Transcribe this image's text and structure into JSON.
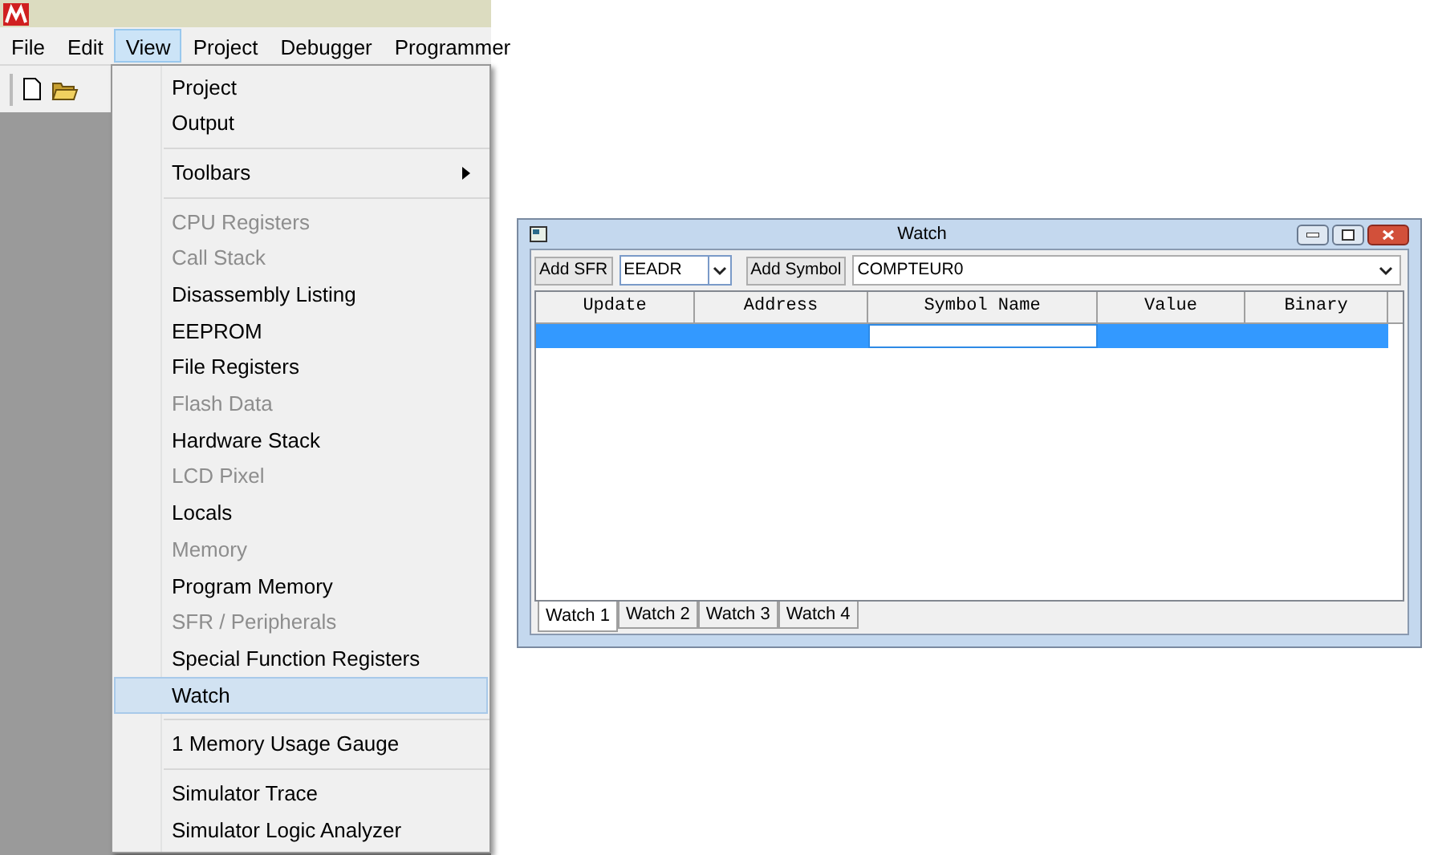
{
  "ide": {
    "menu_bar": [
      {
        "label": "File",
        "selected": false
      },
      {
        "label": "Edit",
        "selected": false
      },
      {
        "label": "View",
        "selected": true
      },
      {
        "label": "Project",
        "selected": false
      },
      {
        "label": "Debugger",
        "selected": false
      },
      {
        "label": "Programmer",
        "selected": false
      }
    ]
  },
  "view_menu": {
    "items": [
      {
        "kind": "item",
        "label": "Project",
        "disabled": false,
        "selected": false
      },
      {
        "kind": "item",
        "label": "Output",
        "disabled": false,
        "selected": false
      },
      {
        "kind": "separator"
      },
      {
        "kind": "submenu",
        "label": "Toolbars",
        "disabled": false,
        "selected": false
      },
      {
        "kind": "separator"
      },
      {
        "kind": "item",
        "label": "CPU Registers",
        "disabled": true,
        "selected": false
      },
      {
        "kind": "item",
        "label": "Call Stack",
        "disabled": true,
        "selected": false
      },
      {
        "kind": "item",
        "label": "Disassembly Listing",
        "disabled": false,
        "selected": false
      },
      {
        "kind": "item",
        "label": "EEPROM",
        "disabled": false,
        "selected": false
      },
      {
        "kind": "item",
        "label": "File Registers",
        "disabled": false,
        "selected": false
      },
      {
        "kind": "item",
        "label": "Flash Data",
        "disabled": true,
        "selected": false
      },
      {
        "kind": "item",
        "label": "Hardware Stack",
        "disabled": false,
        "selected": false
      },
      {
        "kind": "item",
        "label": "LCD Pixel",
        "disabled": true,
        "selected": false
      },
      {
        "kind": "item",
        "label": "Locals",
        "disabled": false,
        "selected": false
      },
      {
        "kind": "item",
        "label": "Memory",
        "disabled": true,
        "selected": false
      },
      {
        "kind": "item",
        "label": "Program Memory",
        "disabled": false,
        "selected": false
      },
      {
        "kind": "item",
        "label": "SFR / Peripherals",
        "disabled": true,
        "selected": false
      },
      {
        "kind": "item",
        "label": "Special Function Registers",
        "disabled": false,
        "selected": false
      },
      {
        "kind": "item",
        "label": "Watch",
        "disabled": false,
        "selected": true
      },
      {
        "kind": "separator"
      },
      {
        "kind": "item",
        "label": "1 Memory Usage Gauge",
        "disabled": false,
        "selected": false
      },
      {
        "kind": "separator"
      },
      {
        "kind": "item",
        "label": "Simulator Trace",
        "disabled": false,
        "selected": false
      },
      {
        "kind": "item",
        "label": "Simulator Logic Analyzer",
        "disabled": false,
        "selected": false
      }
    ]
  },
  "watch_window": {
    "title": "Watch",
    "add_sfr_button": "Add SFR",
    "sfr_select": {
      "value": "EEADR"
    },
    "add_symbol_button": "Add Symbol",
    "symbol_select": {
      "value": "COMPTEUR0"
    },
    "table": {
      "columns": [
        "Update",
        "Address",
        "Symbol Name",
        "Value",
        "Binary"
      ],
      "rows": [
        {
          "selected": true
        }
      ]
    },
    "tabs": [
      {
        "label": "Watch 1",
        "selected": true
      },
      {
        "label": "Watch 2",
        "selected": false
      },
      {
        "label": "Watch 3",
        "selected": false
      },
      {
        "label": "Watch 4",
        "selected": false
      }
    ]
  }
}
